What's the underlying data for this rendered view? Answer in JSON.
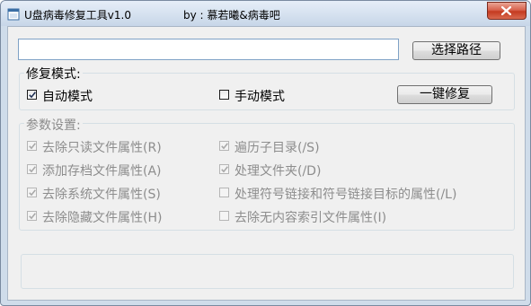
{
  "window": {
    "title": "U盘病毒修复工具v1.0",
    "author": "by : 慕若曦&病毒吧"
  },
  "path_input": {
    "value": "",
    "placeholder": ""
  },
  "buttons": {
    "browse": "选择路径",
    "repair": "一键修复"
  },
  "mode_group": {
    "label": "修复模式:",
    "auto": {
      "label": "自动模式",
      "checked": true
    },
    "manual": {
      "label": "手动模式",
      "checked": false
    }
  },
  "param_group": {
    "label": "参数设置:",
    "options": [
      {
        "label": "去除只读文件属性(R)",
        "checked": true
      },
      {
        "label": "遍历子目录(/S)",
        "checked": true
      },
      {
        "label": "添加存档文件属性(A)",
        "checked": true
      },
      {
        "label": "处理文件夹(/D)",
        "checked": true
      },
      {
        "label": "去除系统文件属性(S)",
        "checked": true
      },
      {
        "label": "处理符号链接和符号链接目标的属性(/L)",
        "checked": false
      },
      {
        "label": "去除隐藏文件属性(H)",
        "checked": true
      },
      {
        "label": "去除无内容索引文件属性(I)",
        "checked": false
      }
    ]
  },
  "colors": {
    "titlebar": "#cfdcea",
    "close_button": "#c9462c",
    "disabled_text": "#8d8d8d"
  }
}
